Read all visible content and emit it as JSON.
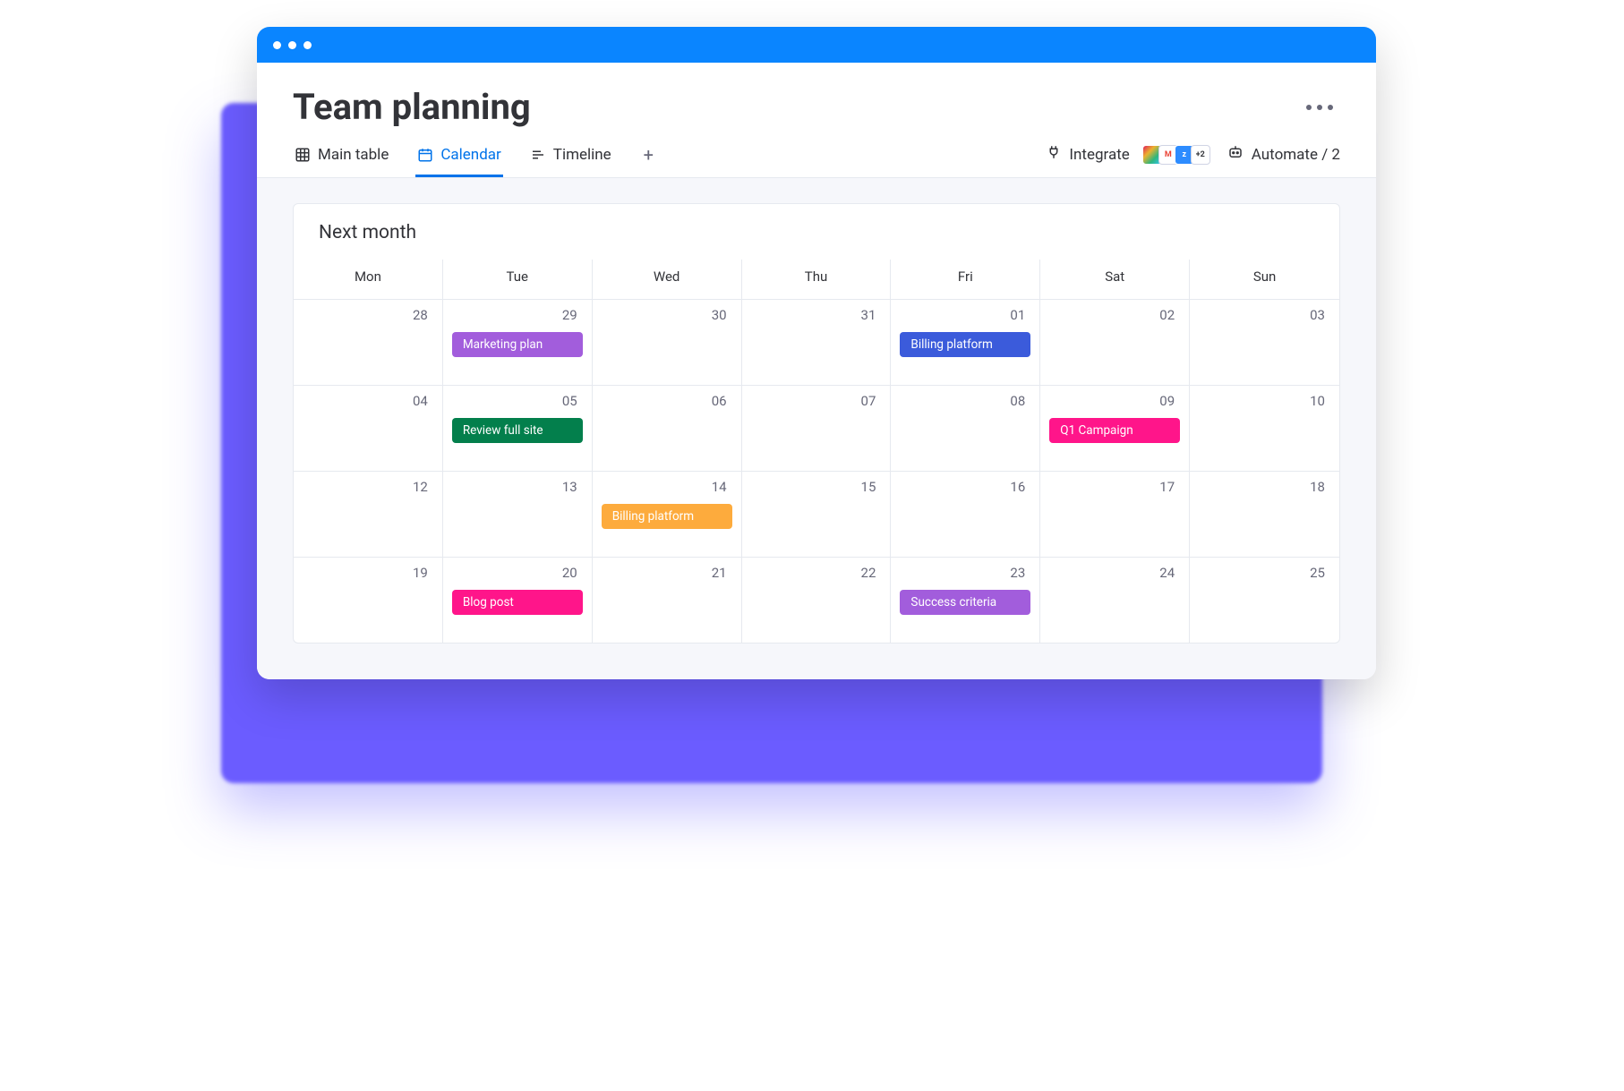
{
  "page_title": "Team planning",
  "tabs": [
    {
      "label": "Main table",
      "icon": "table"
    },
    {
      "label": "Calendar",
      "icon": "calendar",
      "active": true
    },
    {
      "label": "Timeline",
      "icon": "timeline"
    }
  ],
  "toolbar": {
    "integrate_label": "Integrate",
    "integrate_more": "+2",
    "automate_label": "Automate / 2"
  },
  "calendar": {
    "title": "Next month",
    "weekdays": [
      "Mon",
      "Tue",
      "Wed",
      "Thu",
      "Fri",
      "Sat",
      "Sun"
    ],
    "days": [
      "28",
      "29",
      "30",
      "31",
      "01",
      "02",
      "03",
      "04",
      "05",
      "06",
      "07",
      "08",
      "09",
      "10",
      "12",
      "13",
      "14",
      "15",
      "16",
      "17",
      "18",
      "19",
      "20",
      "21",
      "22",
      "23",
      "24",
      "25"
    ],
    "events": {
      "1": {
        "label": "Marketing plan",
        "color": "#a25ddc"
      },
      "4": {
        "label": "Billing platform",
        "color": "#3b5bdb"
      },
      "8": {
        "label": "Review full site",
        "color": "#037f4c"
      },
      "12": {
        "label": "Q1 Campaign",
        "color": "#ff158a"
      },
      "16": {
        "label": "Billing platform",
        "color": "#fdab3d"
      },
      "22": {
        "label": "Blog post",
        "color": "#ff158a"
      },
      "25": {
        "label": "Success criteria",
        "color": "#a25ddc"
      }
    }
  }
}
